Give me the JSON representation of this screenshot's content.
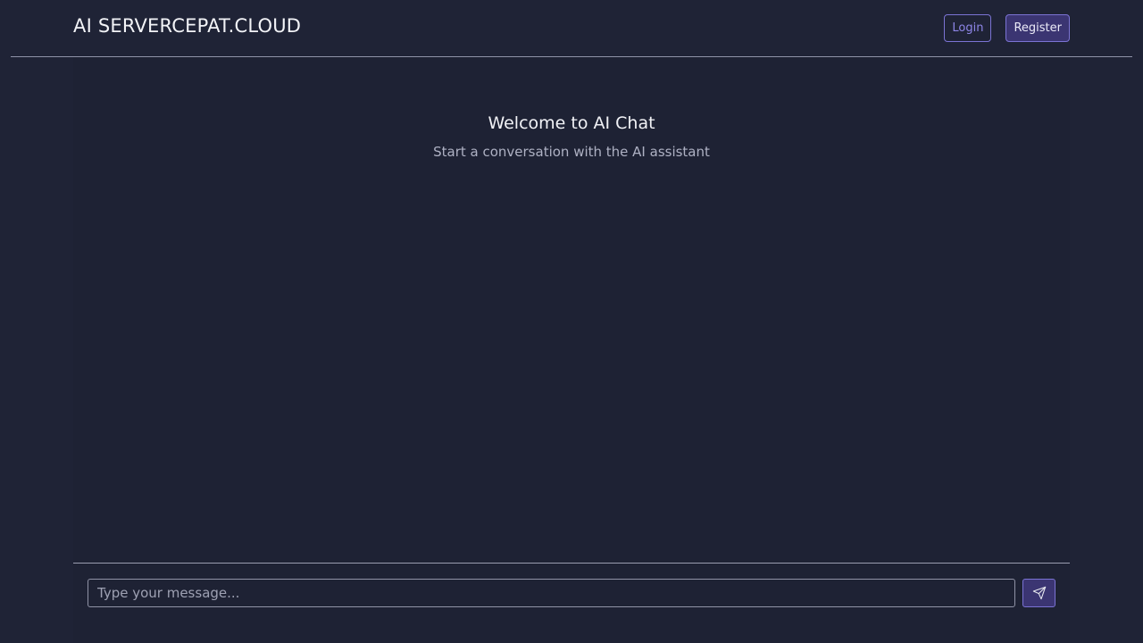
{
  "header": {
    "brand": "AI SERVERCEPAT.CLOUD",
    "login_label": "Login",
    "register_label": "Register"
  },
  "main": {
    "welcome_title": "Welcome to AI Chat",
    "welcome_subtitle": "Start a conversation with the AI assistant"
  },
  "composer": {
    "input_value": "",
    "input_placeholder": "Type your message...",
    "send_icon": "send-icon"
  },
  "colors": {
    "background": "#1f2336",
    "accent": "#7b73d4",
    "accent_fill": "#3b3572",
    "divider": "#8f93a8"
  }
}
